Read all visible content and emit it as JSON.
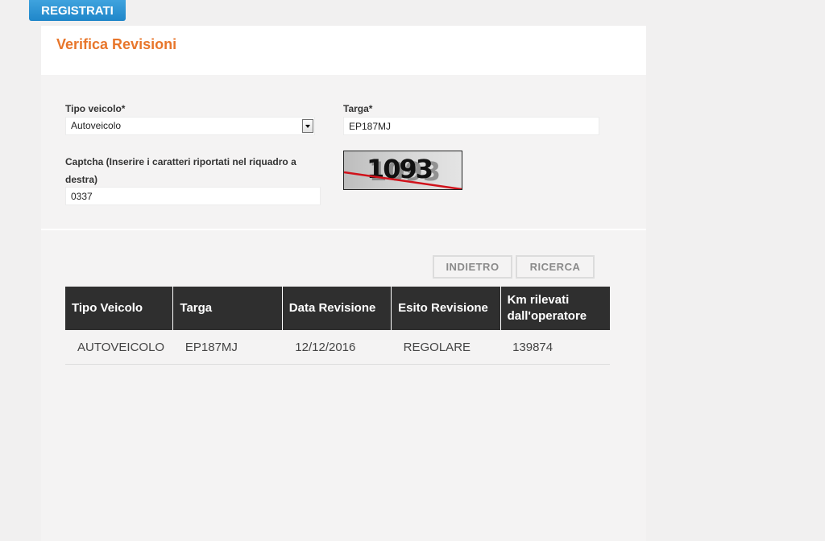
{
  "header": {
    "register_label": "REGISTRATI"
  },
  "panel": {
    "title": "Verifica Revisioni"
  },
  "form": {
    "vehicle_type_label": "Tipo veicolo*",
    "vehicle_type_value": "Autoveicolo",
    "plate_label": "Targa*",
    "plate_value": "EP187MJ",
    "captcha_label": "Captcha (Inserire i caratteri riportati nel riquadro a destra)",
    "captcha_value": "0337",
    "captcha_image_text": "1093"
  },
  "buttons": {
    "back_label": "INDIETRO",
    "search_label": "RICERCA"
  },
  "table": {
    "headers": [
      "Tipo Veicolo",
      "Targa",
      "Data Revisione",
      "Esito Revisione",
      "Km rilevati dall'operatore"
    ],
    "rows": [
      [
        "AUTOVEICOLO",
        "EP187MJ",
        "12/12/2016",
        "REGOLARE",
        "139874"
      ]
    ]
  },
  "colors": {
    "accent_orange": "#e8762b",
    "button_blue": "#1f86c9",
    "table_header_bg": "#2f2f2f"
  }
}
